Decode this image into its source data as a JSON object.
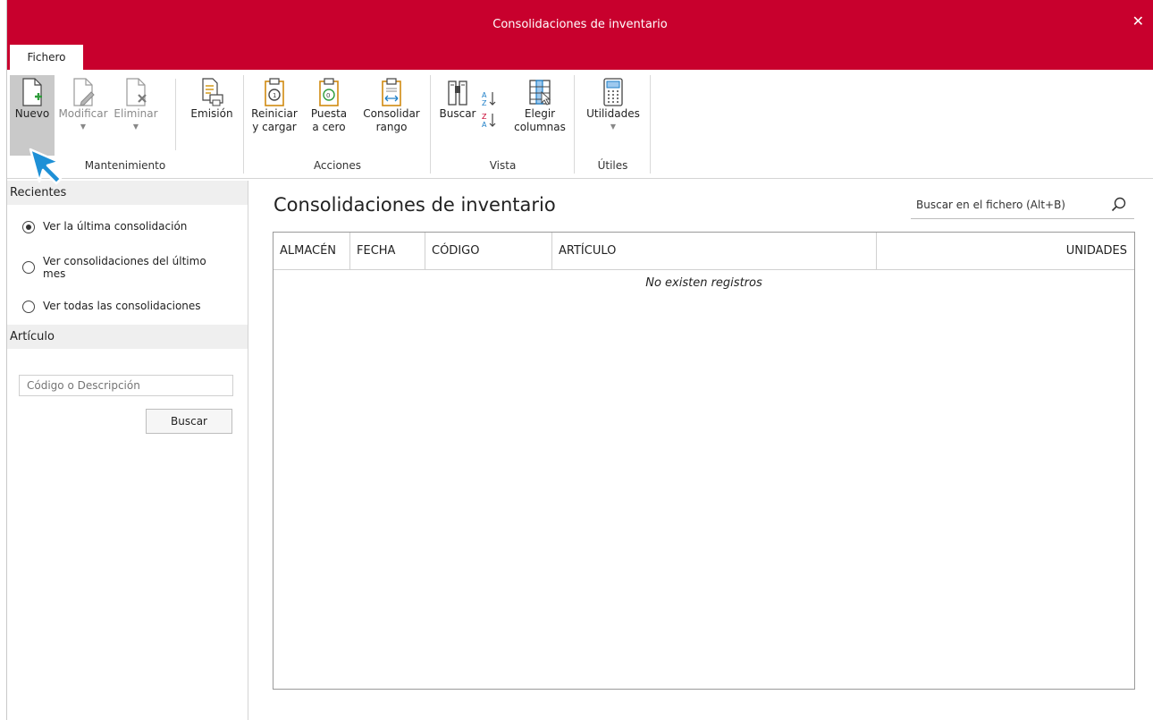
{
  "window": {
    "title": "Consolidaciones de inventario",
    "close_label": "✕"
  },
  "tabs": {
    "fichero": "Fichero"
  },
  "ribbon": {
    "mantenimiento": {
      "label": "Mantenimiento",
      "nuevo": "Nuevo",
      "modificar": "Modificar",
      "eliminar": "Eliminar",
      "emision": "Emisión"
    },
    "acciones": {
      "label": "Acciones",
      "reiniciar_1": "Reiniciar",
      "reiniciar_2": "y cargar",
      "puesta_1": "Puesta",
      "puesta_2": "a cero",
      "consolidar_1": "Consolidar",
      "consolidar_2": "rango"
    },
    "vista": {
      "label": "Vista",
      "buscar": "Buscar",
      "elegir_1": "Elegir",
      "elegir_2": "columnas"
    },
    "utiles": {
      "label": "Útiles",
      "utilidades": "Utilidades"
    }
  },
  "sidebar": {
    "recientes_title": "Recientes",
    "options": [
      {
        "label": "Ver la última consolidación",
        "selected": true
      },
      {
        "label": "Ver consolidaciones del último mes",
        "selected": false
      },
      {
        "label": "Ver todas las consolidaciones",
        "selected": false
      }
    ],
    "articulo_title": "Artículo",
    "articulo_placeholder": "Código o Descripción",
    "buscar_button": "Buscar"
  },
  "main": {
    "title": "Consolidaciones de inventario",
    "search_placeholder": "Buscar en el fichero (Alt+B)",
    "columns": [
      "ALMACÉN",
      "FECHA",
      "CÓDIGO",
      "ARTÍCULO",
      "UNIDADES"
    ],
    "empty_message": "No existen registros"
  },
  "colors": {
    "accent": "#c8002d",
    "cursor": "#1e90d6"
  },
  "icons": [
    "new-document-icon",
    "edit-document-icon",
    "delete-document-icon",
    "print-icon",
    "clipboard-reset-icon",
    "clipboard-zero-icon",
    "clipboard-range-icon",
    "binoculars-icon",
    "sort-az-icon",
    "sort-za-icon",
    "columns-icon",
    "calculator-icon",
    "search-icon",
    "mouse-cursor-icon"
  ]
}
